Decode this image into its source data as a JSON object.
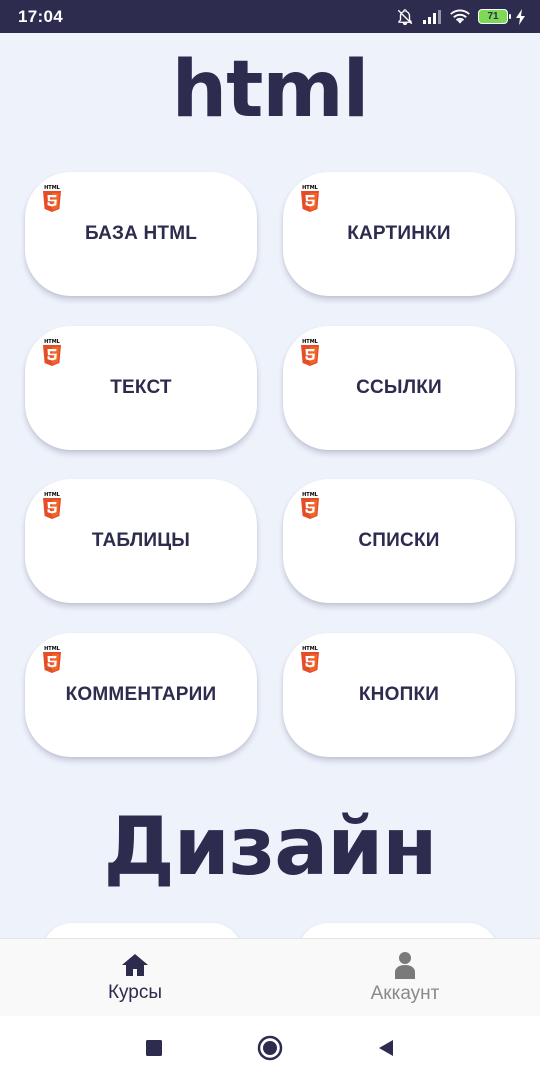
{
  "status_bar": {
    "time": "17:04",
    "battery_level": "71",
    "icons": [
      "bell-off-icon",
      "signal-icon",
      "wifi-icon",
      "battery-icon",
      "charging-icon"
    ]
  },
  "sections": [
    {
      "title": "html",
      "cards": [
        {
          "label": "БАЗА HTML",
          "icon": "html5-icon"
        },
        {
          "label": "КАРТИНКИ",
          "icon": "html5-icon"
        },
        {
          "label": "ТЕКСТ",
          "icon": "html5-icon"
        },
        {
          "label": "ССЫЛКИ",
          "icon": "html5-icon"
        },
        {
          "label": "ТАБЛИЦЫ",
          "icon": "html5-icon"
        },
        {
          "label": "СПИСКИ",
          "icon": "html5-icon"
        },
        {
          "label": "КОММЕНТАРИИ",
          "icon": "html5-icon"
        },
        {
          "label": "КНОПКИ",
          "icon": "html5-icon"
        }
      ]
    },
    {
      "title": "Дизайн",
      "cards": []
    }
  ],
  "badge_text": "HTML",
  "bottom_nav": {
    "items": [
      {
        "label": "Курсы",
        "icon": "home-icon",
        "active": true
      },
      {
        "label": "Аккаунт",
        "icon": "person-icon",
        "active": false
      }
    ]
  },
  "colors": {
    "primary": "#2d2b4e",
    "background": "#eef2fb",
    "html5_orange": "#e44d26",
    "html5_light": "#f16529",
    "inactive": "#8a8a8a"
  }
}
